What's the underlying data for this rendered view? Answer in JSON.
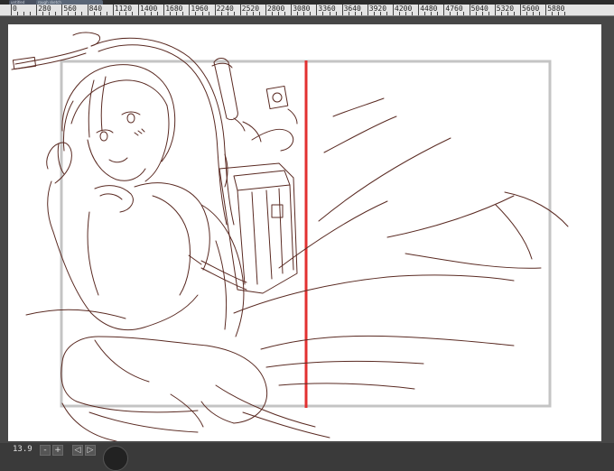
{
  "tabs": [
    {
      "label": "untitled"
    },
    {
      "label": "rough sketch"
    }
  ],
  "ruler": {
    "labels": [
      "0",
      "280",
      "560",
      "840",
      "1120",
      "1400",
      "1680",
      "1960",
      "2240",
      "2520",
      "2800",
      "3080",
      "3360",
      "3640",
      "3920",
      "4200",
      "4480",
      "4760",
      "5040",
      "5320",
      "5600",
      "5880"
    ]
  },
  "status": {
    "zoom": "13.9",
    "buttons": [
      "-",
      "+",
      "◁",
      "▷"
    ]
  },
  "colors": {
    "line_color": "#5a2a22",
    "guide_red": "#e23030",
    "frame_grey": "#c4c4c4"
  }
}
